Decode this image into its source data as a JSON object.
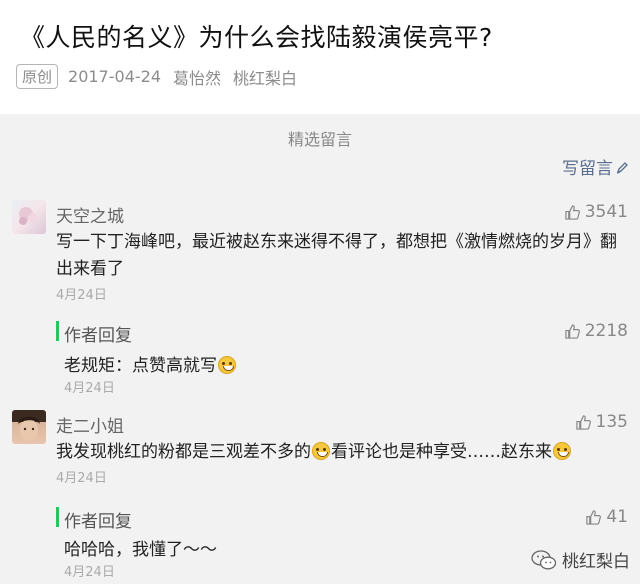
{
  "article": {
    "title": "《人民的名义》为什么会找陆毅演侯亮平?",
    "tag": "原创",
    "date": "2017-04-24",
    "author": "葛怡然",
    "account": "桃红梨白"
  },
  "comments_section": {
    "title": "精选留言",
    "write_label": "写留言"
  },
  "comments": [
    {
      "nickname": "天空之城",
      "likes": "3541",
      "text": "写一下丁海峰吧，最近被赵东来迷得不得了，都想把《激情燃烧的岁月》翻出来看了",
      "date": "4月24日",
      "reply": {
        "label": "作者回复",
        "likes": "2218",
        "text": "老规矩：点赞高就写",
        "date": "4月24日"
      }
    },
    {
      "nickname": "走二小姐",
      "likes": "135",
      "text_a": "我发现桃红的粉都是三观差不多的",
      "text_b": "看评论也是种享受……赵东来",
      "date": "4月24日",
      "reply": {
        "label": "作者回复",
        "likes": "41",
        "text": "哈哈哈，我懂了～～",
        "date": "4月24日"
      }
    }
  ],
  "watermark": {
    "text": "桃红梨白"
  },
  "colors": {
    "reply_bar": "#2bc35a",
    "link": "#5a6f8f"
  },
  "icons": [
    "pencil-icon",
    "thumbs-up-icon",
    "grin-emoji-icon",
    "wechat-icon"
  ]
}
